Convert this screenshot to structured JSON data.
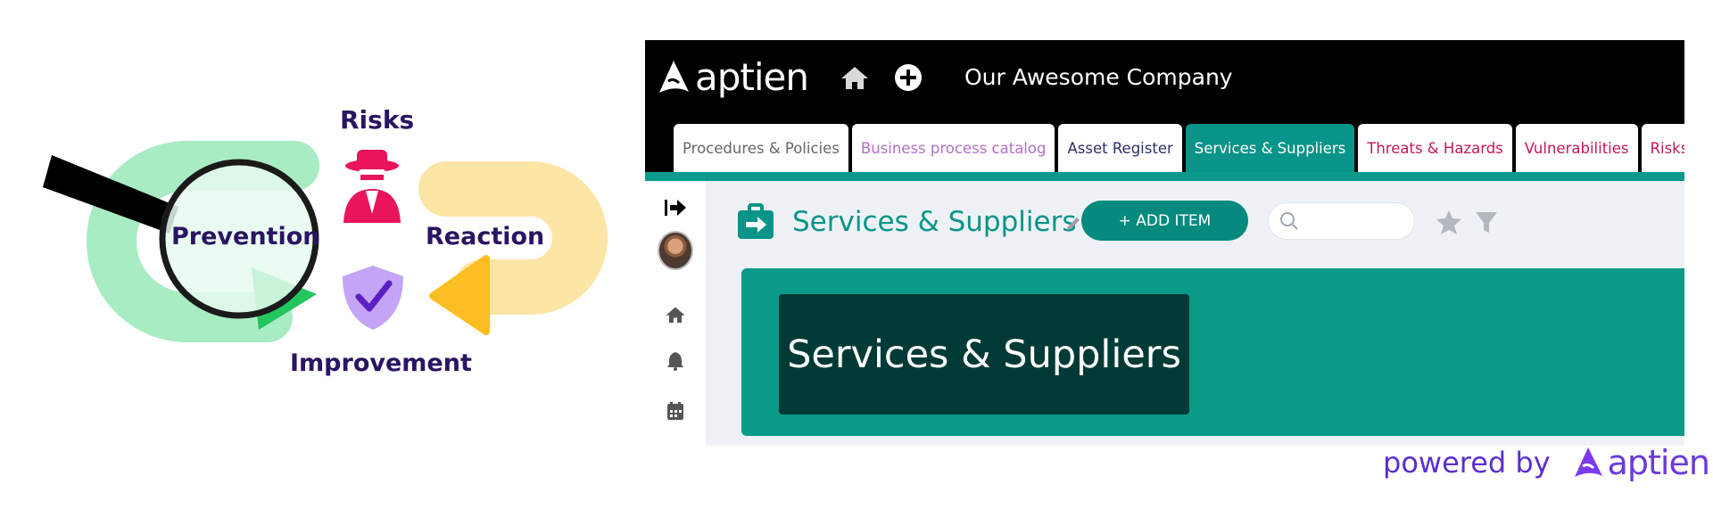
{
  "illustration": {
    "risks_label": "Risks",
    "prevention_label": "Prevention",
    "reaction_label": "Reaction",
    "improvement_label": "Improvement",
    "colors": {
      "label": "#2a1463",
      "green": "#22c55e",
      "yellow": "#fbbf24",
      "red": "#e8155c",
      "purple": "#b58af5"
    }
  },
  "app": {
    "brand_name": "aptien",
    "company_name": "Our Awesome Company",
    "icons": {
      "home": "home-icon",
      "add": "plus-circle-icon"
    },
    "tabs": [
      {
        "label": "Procedures & Policies",
        "color": "#666666",
        "active": false
      },
      {
        "label": "Business process catalog",
        "color": "#b46fc4",
        "active": false
      },
      {
        "label": "Asset Register",
        "color": "#2b2f66",
        "active": false
      },
      {
        "label": "Services & Suppliers",
        "color": "#ffffff",
        "active": true
      },
      {
        "label": "Threats & Hazards",
        "color": "#c2185b",
        "active": false
      },
      {
        "label": "Vulnerabilities",
        "color": "#c2185b",
        "active": false
      },
      {
        "label": "Risks",
        "color": "#c2185b",
        "active": false
      }
    ],
    "sidebar_icons": [
      "logout-arrow-icon",
      "avatar",
      "home-icon",
      "bell-icon",
      "calendar-icon"
    ],
    "page_title": "Services & Suppliers",
    "add_button_label": "+ ADD ITEM",
    "search_placeholder": "",
    "banner_title": "Services & Suppliers",
    "accent_color": "#089488"
  },
  "powered_by": {
    "text": "powered by",
    "brand": "aptien"
  }
}
